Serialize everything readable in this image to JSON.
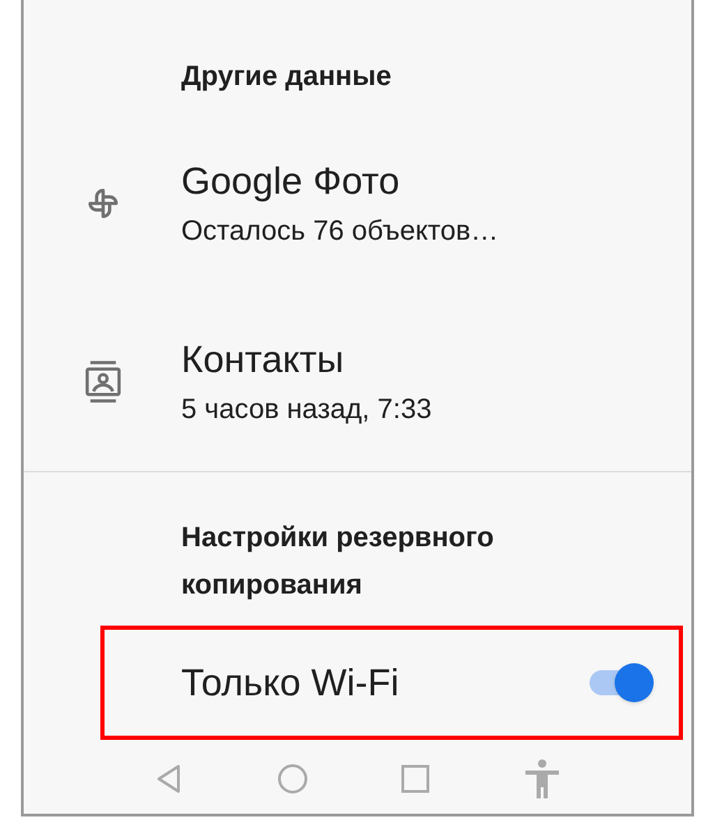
{
  "sections": [
    {
      "header": "Другие данные",
      "items": [
        {
          "kind": "photos",
          "title": "Google Фото",
          "subtitle": "Осталось 76 объектов…"
        },
        {
          "kind": "contacts",
          "title": "Контакты",
          "subtitle": "5 часов назад, 7:33"
        }
      ]
    },
    {
      "header": "Настройки резервного копирования",
      "toggles": [
        {
          "label": "Только Wi-Fi",
          "on": true,
          "highlighted": true
        }
      ]
    }
  ]
}
